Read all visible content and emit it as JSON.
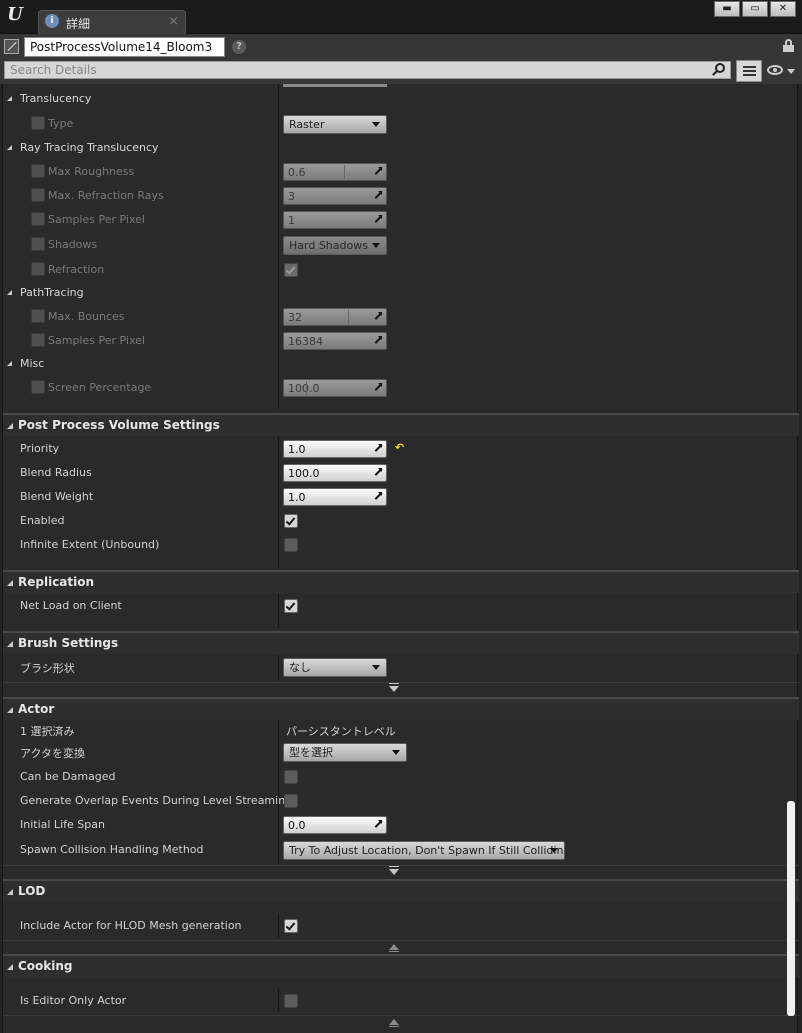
{
  "window": {
    "tab_label": "詳細",
    "tab_icon": "i",
    "close_glyph": "×",
    "min_glyph": "▬",
    "max_glyph": "▭",
    "x_glyph": "✕"
  },
  "actor": {
    "name": "PostProcessVolume14_Bloom3",
    "help": "?"
  },
  "search": {
    "placeholder": "Search Details"
  },
  "translucency": {
    "header": "Translucency",
    "type_label": "Type",
    "type_value": "Raster"
  },
  "rt_translucency": {
    "header": "Ray Tracing Translucency",
    "max_roughness_label": "Max Roughness",
    "max_roughness_value": "0.6",
    "max_refraction_label": "Max. Refraction Rays",
    "max_refraction_value": "3",
    "samples_label": "Samples Per Pixel",
    "samples_value": "1",
    "shadows_label": "Shadows",
    "shadows_value": "Hard Shadows",
    "refraction_label": "Refraction"
  },
  "path_tracing": {
    "header": "PathTracing",
    "bounces_label": "Max. Bounces",
    "bounces_value": "32",
    "samples_label": "Samples Per Pixel",
    "samples_value": "16384"
  },
  "misc": {
    "header": "Misc",
    "screen_pct_label": "Screen Percentage",
    "screen_pct_value": "100.0"
  },
  "ppv_settings": {
    "header": "Post Process Volume Settings",
    "priority_label": "Priority",
    "priority_value": "1.0",
    "reset_glyph": "↶",
    "blend_radius_label": "Blend Radius",
    "blend_radius_value": "100.0",
    "blend_weight_label": "Blend Weight",
    "blend_weight_value": "1.0",
    "enabled_label": "Enabled",
    "infinite_label": "Infinite Extent (Unbound)"
  },
  "replication": {
    "header": "Replication",
    "net_load_label": "Net Load on Client"
  },
  "brush": {
    "header": "Brush Settings",
    "shape_label": "ブラシ形状",
    "shape_value": "なし"
  },
  "actor_section": {
    "header": "Actor",
    "selected_label": "1 選択済み",
    "selected_value": "パーシスタントレベル",
    "convert_label": "アクタを変換",
    "convert_value": "型を選択",
    "damaged_label": "Can be Damaged",
    "overlap_label": "Generate Overlap Events During Level Streaming",
    "life_span_label": "Initial Life Span",
    "life_span_value": "0.0",
    "spawn_label": "Spawn Collision Handling Method",
    "spawn_value": "Try To Adjust Location, Don't Spawn If Still Colliding"
  },
  "lod": {
    "header": "LOD",
    "hlod_label": "Include Actor for HLOD Mesh generation"
  },
  "cooking": {
    "header": "Cooking",
    "editor_only_label": "Is Editor Only Actor"
  }
}
